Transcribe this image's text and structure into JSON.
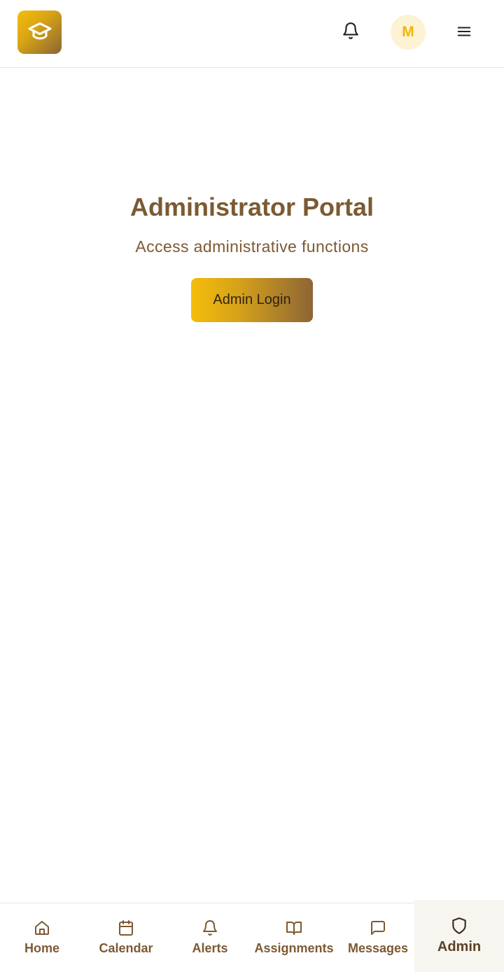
{
  "header": {
    "logo_icon": "graduation-cap-icon",
    "notifications_icon": "bell-icon",
    "avatar_initial": "M",
    "menu_icon": "hamburger-menu-icon"
  },
  "main": {
    "title": "Administrator Portal",
    "subtitle": "Access administrative functions",
    "login_button": "Admin Login"
  },
  "bottom_nav": {
    "items": [
      {
        "label": "Home",
        "icon": "home-icon"
      },
      {
        "label": "Calendar",
        "icon": "calendar-icon"
      },
      {
        "label": "Alerts",
        "icon": "bell-icon"
      },
      {
        "label": "Assignments",
        "icon": "book-open-icon"
      },
      {
        "label": "Messages",
        "icon": "message-square-icon"
      },
      {
        "label": "Admin",
        "icon": "shield-icon",
        "active": true
      }
    ]
  },
  "colors": {
    "brand_gold": "#f5bd0a",
    "brand_brown": "#8a6434",
    "text_brown": "#7b5a33",
    "avatar_bg": "#fdf3d4"
  }
}
